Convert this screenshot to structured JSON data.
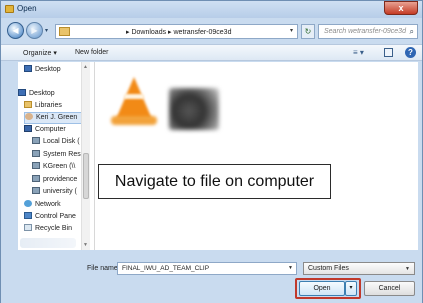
{
  "window": {
    "title": "Open",
    "close_glyph": "x"
  },
  "address": {
    "breadcrumbs": "▸ Downloads ▸ wetransfer-09ce3d",
    "dropdown_glyph": "▾",
    "refresh_glyph": "↻",
    "search_placeholder": "Search wetransfer-09ce3d",
    "search_glyph": "⌕"
  },
  "toolbar": {
    "organize_label": "Organize ▾",
    "new_folder_label": "New folder",
    "view_glyph": "≡ ▾",
    "help_glyph": "?"
  },
  "nav": {
    "items": [
      {
        "label": "Desktop",
        "icon": "desktop-icon"
      },
      {
        "label": "Desktop",
        "icon": "desktop-icon"
      },
      {
        "label": "Libraries",
        "icon": "libraries-icon"
      },
      {
        "label": "Keri J. Green",
        "icon": "user-folder-icon"
      },
      {
        "label": "Computer",
        "icon": "computer-icon"
      },
      {
        "label": "Local Disk (",
        "icon": "disk-icon"
      },
      {
        "label": "System Res",
        "icon": "disk-icon"
      },
      {
        "label": "KGreen (\\\\",
        "icon": "network-drive-icon"
      },
      {
        "label": "providence",
        "icon": "network-drive-icon"
      },
      {
        "label": "university (",
        "icon": "network-drive-icon"
      },
      {
        "label": "Network",
        "icon": "network-icon"
      },
      {
        "label": "Control Pane",
        "icon": "control-panel-icon"
      },
      {
        "label": "Recycle Bin",
        "icon": "recycle-bin-icon"
      }
    ]
  },
  "overlay": {
    "callout_text": "Navigate to file on computer"
  },
  "bottom": {
    "file_name_label": "File name:",
    "file_name_value": "FINAL_IWU_AD_TEAM_CLIP",
    "file_type_value": "Custom Files",
    "open_label": "Open",
    "open_split_glyph": "▾",
    "cancel_label": "Cancel"
  },
  "colors": {
    "highlight": "#c0392b",
    "title_bar": "#c9dbef",
    "close": "#c43b25"
  }
}
